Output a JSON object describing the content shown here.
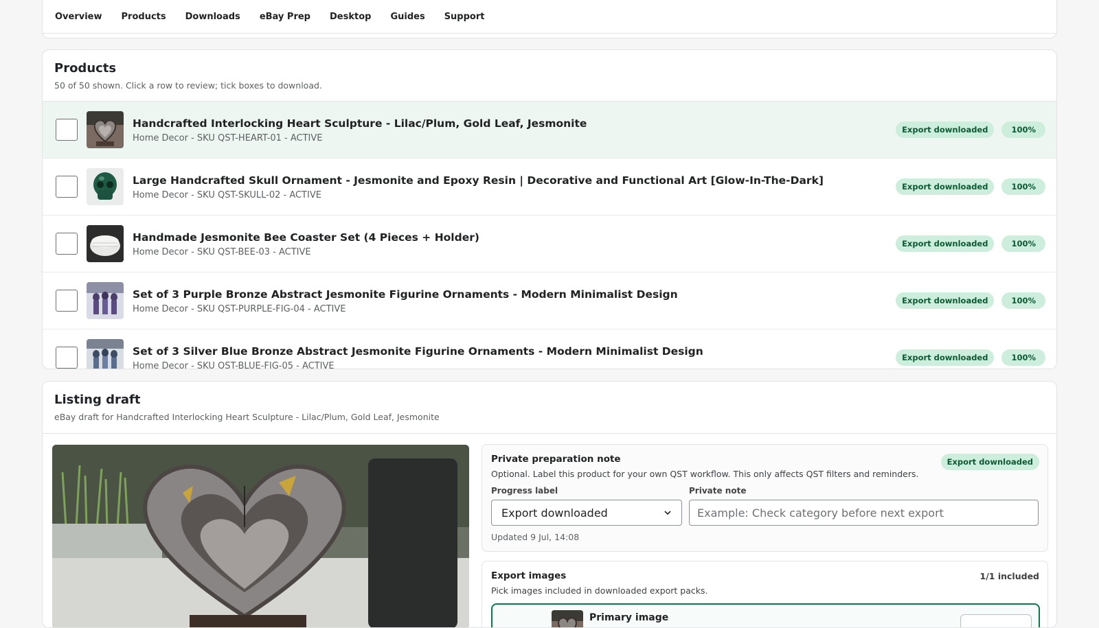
{
  "nav": {
    "tabs": [
      "Overview",
      "Products",
      "Downloads",
      "eBay Prep",
      "Desktop",
      "Guides",
      "Support"
    ]
  },
  "products": {
    "title": "Products",
    "subtitle": "50 of 50 shown. Click a row to review; tick boxes to download.",
    "rows": [
      {
        "title": "Handcrafted Interlocking Heart Sculpture - Lilac/Plum, Gold Leaf, Jesmonite",
        "meta": "Home Decor - SKU QST-HEART-01 - ACTIVE",
        "status": "Export downloaded",
        "progress": "100%",
        "thumb_icon": "heart-sculpture-photo"
      },
      {
        "title": "Large Handcrafted Skull Ornament - Jesmonite and Epoxy Resin | Decorative and Functional Art [Glow-In-The-Dark]",
        "meta": "Home Decor - SKU QST-SKULL-02 - ACTIVE",
        "status": "Export downloaded",
        "progress": "100%",
        "thumb_icon": "green-skull-photo"
      },
      {
        "title": "Handmade Jesmonite Bee Coaster Set (4 Pieces + Holder)",
        "meta": "Home Decor - SKU QST-BEE-03 - ACTIVE",
        "status": "Export downloaded",
        "progress": "100%",
        "thumb_icon": "coaster-set-photo"
      },
      {
        "title": "Set of 3 Purple Bronze Abstract Jesmonite Figurine Ornaments - Modern Minimalist Design",
        "meta": "Home Decor - SKU QST-PURPLE-FIG-04 - ACTIVE",
        "status": "Export downloaded",
        "progress": "100%",
        "thumb_icon": "purple-figurines-photo"
      },
      {
        "title": "Set of 3 Silver Blue Bronze Abstract Jesmonite Figurine Ornaments - Modern Minimalist Design",
        "meta": "Home Decor - SKU QST-BLUE-FIG-05 - ACTIVE",
        "status": "Export downloaded",
        "progress": "100%",
        "thumb_icon": "blue-figurines-photo"
      }
    ]
  },
  "draft": {
    "title": "Listing draft",
    "subtitle": "eBay draft for Handcrafted Interlocking Heart Sculpture - Lilac/Plum, Gold Leaf, Jesmonite",
    "prep": {
      "title": "Private preparation note",
      "subtitle": "Optional. Label this product for your own QST workflow. This only affects QST filters and reminders.",
      "badge": "Export downloaded",
      "progress_label": "Progress label",
      "progress_value": "Export downloaded",
      "note_label": "Private note",
      "note_placeholder": "Example: Check category before next export",
      "updated": "Updated 9 Jul, 14:08"
    },
    "images": {
      "title": "Export images",
      "subtitle": "Pick images included in downloaded export packs.",
      "count": "1/1 included",
      "primary_label": "Primary image"
    }
  },
  "colors": {
    "accent": "#0b7a4b",
    "badge_bg": "#cdeedd",
    "badge_text": "#0b5a34",
    "selected_row": "#eef6f2"
  }
}
